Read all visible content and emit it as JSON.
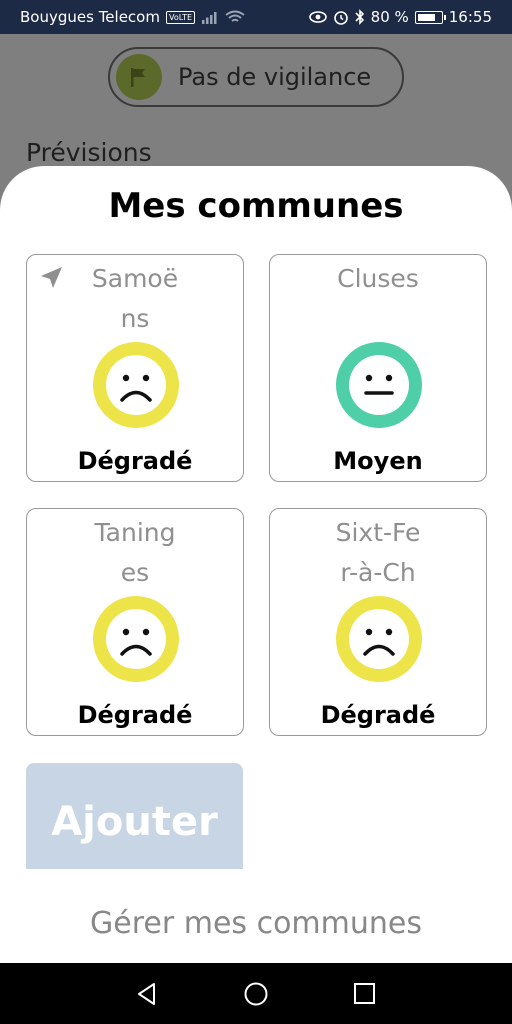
{
  "status_bar": {
    "carrier": "Bouygues Telecom",
    "volte": "VoLTE",
    "battery_percent": "80 %",
    "battery_level": 0.8,
    "time": "16:55",
    "icons": [
      "signal-icon",
      "wifi-icon",
      "eye-icon",
      "alarm-icon",
      "bluetooth-icon",
      "battery-icon"
    ]
  },
  "background": {
    "vigilance_label": "Pas de vigilance",
    "previsions_title": "Prévisions"
  },
  "sheet": {
    "title": "Mes communes",
    "communes": [
      {
        "name": "Samoëns",
        "name_lines": [
          "Samoë",
          "ns"
        ],
        "status": "Dégradé",
        "face": "sad",
        "face_color": "#ede44a",
        "current_location": true
      },
      {
        "name": "Cluses",
        "name_lines": [
          "Cluses"
        ],
        "status": "Moyen",
        "face": "neutral",
        "face_color": "#4fcfa8",
        "current_location": false
      },
      {
        "name": "Taninges",
        "name_lines": [
          "Taning",
          "es"
        ],
        "status": "Dégradé",
        "face": "sad",
        "face_color": "#ede44a",
        "current_location": false
      },
      {
        "name": "Sixt-Fer-à-Ch",
        "name_lines": [
          "Sixt-Fe",
          "r-à-Ch"
        ],
        "status": "Dégradé",
        "face": "sad",
        "face_color": "#ede44a",
        "current_location": false
      }
    ],
    "add_label": "Ajouter",
    "manage_label": "Gérer mes communes"
  },
  "colors": {
    "status_bar_bg": "#1d2a45",
    "overlay_bg": "#7f7f7f",
    "add_button_bg": "#c8d5e4",
    "degrade": "#ede44a",
    "moyen": "#4fcfa8"
  },
  "navbar": {
    "icons": [
      "back-icon",
      "home-icon",
      "recents-icon"
    ]
  }
}
